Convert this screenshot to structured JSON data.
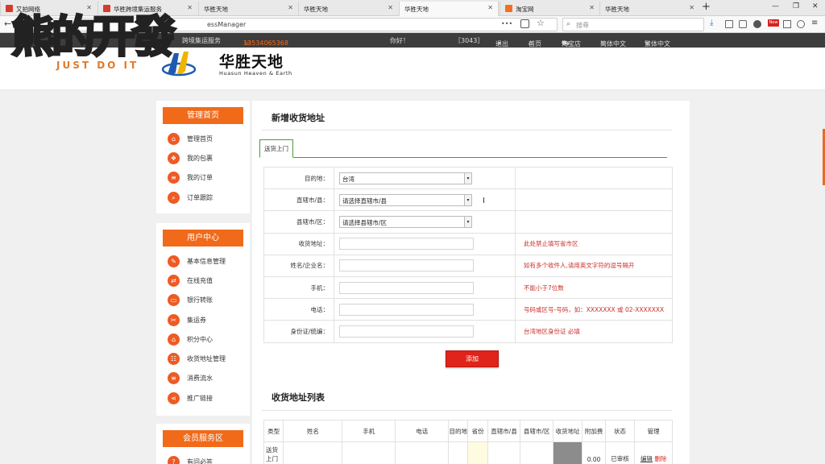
{
  "browser": {
    "tabs": [
      {
        "label": "又拍网络",
        "favicon": "#d63b2b"
      },
      {
        "label": "华胜跨境集运服务",
        "favicon": "#d63b2b"
      },
      {
        "label": "华胜天地",
        "favicon": ""
      },
      {
        "label": "华胜天地",
        "favicon": ""
      },
      {
        "label": "华胜天地",
        "favicon": ""
      },
      {
        "label": "淘宝网",
        "favicon": "#f36f20"
      },
      {
        "label": "华胜天地",
        "favicon": ""
      }
    ],
    "url": "essManager",
    "search_placeholder": "搜尋",
    "new_tab": "+",
    "badge": "New"
  },
  "watermark": {
    "big": "熊的开發",
    "small": "JUST DO IT"
  },
  "topstrip": {
    "service": "跨境集运服务",
    "phone": "13534065368",
    "greeting": "你好！",
    "user_id": "［3043］",
    "logout": "退出",
    "home": "首页",
    "taobao": "淘宝店",
    "simplified": "简体中文",
    "traditional": "繁体中文"
  },
  "logo": {
    "name": "华胜天地",
    "english": "Huasun Heaven & Earth"
  },
  "sidebar": {
    "groups": [
      {
        "title": "管理首页",
        "items": [
          {
            "label": "管理首页",
            "icon": "home-icon",
            "glyph": "⌂"
          },
          {
            "label": "我的包裹",
            "icon": "package-icon",
            "glyph": "❖"
          },
          {
            "label": "我的订单",
            "icon": "list-icon",
            "glyph": "≡"
          },
          {
            "label": "订单跟踪",
            "icon": "search-icon",
            "glyph": "⌕"
          }
        ]
      },
      {
        "title": "用户中心",
        "items": [
          {
            "label": "基本信息管理",
            "icon": "edit-icon",
            "glyph": "✎"
          },
          {
            "label": "在线充值",
            "icon": "exchange-icon",
            "glyph": "⇄"
          },
          {
            "label": "银行转账",
            "icon": "card-icon",
            "glyph": "▭"
          },
          {
            "label": "集运券",
            "icon": "ticket-icon",
            "glyph": "✂"
          },
          {
            "label": "积分中心",
            "icon": "bank-icon",
            "glyph": "⌂"
          },
          {
            "label": "收货地址管理",
            "icon": "address-card-icon",
            "glyph": "☷"
          },
          {
            "label": "消费流水",
            "icon": "list-icon",
            "glyph": "≡"
          },
          {
            "label": "推广链接",
            "icon": "share-icon",
            "glyph": "⋖"
          }
        ]
      },
      {
        "title": "会员服务区",
        "items": [
          {
            "label": "有问必答",
            "icon": "question-icon",
            "glyph": "?"
          }
        ]
      }
    ]
  },
  "form": {
    "title": "新增收货地址",
    "tab": "送货上门",
    "rows": [
      {
        "label": "目的地：",
        "type": "select",
        "value": "台湾",
        "tip": ""
      },
      {
        "label": "直辖市/县：",
        "type": "select",
        "value": "请选择直辖市/县",
        "tip": ""
      },
      {
        "label": "县辖市/区：",
        "type": "select",
        "value": "请选择县辖市/区",
        "tip": ""
      },
      {
        "label": "收货地址：",
        "type": "input",
        "value": "",
        "tip": "此处禁止填写省市区"
      },
      {
        "label": "姓名/企业名：",
        "type": "input",
        "value": "",
        "tip": "如有多个收件人,请用英文字符的逗号隔开"
      },
      {
        "label": "手机：",
        "type": "input",
        "value": "",
        "tip": "不能小于7位数"
      },
      {
        "label": "电话：",
        "type": "input",
        "value": "",
        "tip": "号码或区号-号码，如：XXXXXXX 或 02-XXXXXXX"
      },
      {
        "label": "身份证/统编：",
        "type": "input",
        "value": "",
        "tip": "台湾地区身份证 必填"
      }
    ],
    "submit": "添加"
  },
  "list": {
    "title": "收货地址列表",
    "columns": [
      "类型",
      "姓名",
      "手机",
      "电话",
      "目的地",
      "省份",
      "直辖市/县",
      "县辖市/区",
      "收货地址",
      "附加费",
      "状态",
      "管理"
    ],
    "row": {
      "type": "送货上门",
      "fee": "0.00",
      "status": "已审核",
      "edit": "编辑",
      "delete": "删除"
    }
  },
  "colors": {
    "accent": "#f06a1a",
    "danger": "#e0241b",
    "tip": "#c9302c",
    "tab_green": "#4a9a3c"
  }
}
